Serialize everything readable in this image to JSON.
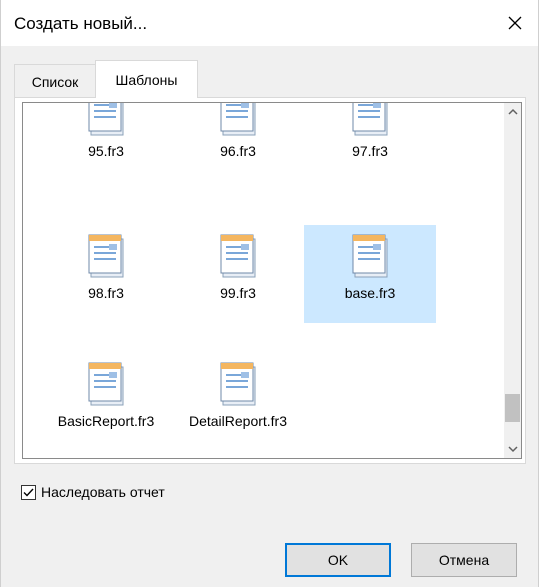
{
  "window": {
    "title": "Создать новый...",
    "close_glyph": "✕"
  },
  "tabs": [
    {
      "label": "Список",
      "active": false
    },
    {
      "label": "Шаблоны",
      "active": true
    }
  ],
  "templates": [
    {
      "label": "95.fr3",
      "selected": false
    },
    {
      "label": "96.fr3",
      "selected": false
    },
    {
      "label": "97.fr3",
      "selected": false
    },
    {
      "label": "98.fr3",
      "selected": false
    },
    {
      "label": "99.fr3",
      "selected": false
    },
    {
      "label": "base.fr3",
      "selected": true
    },
    {
      "label": "BasicReport.fr3",
      "selected": false
    },
    {
      "label": "DetailReport.fr3",
      "selected": false
    }
  ],
  "scrollbar": {
    "up_glyph": "⌃",
    "down_glyph": "⌄"
  },
  "inherit": {
    "label": "Наследовать отчет",
    "checked": true
  },
  "buttons": {
    "ok": "OK",
    "cancel": "Отмена"
  },
  "icons": {
    "template": "report-template-icon",
    "accent": "#0078d7",
    "selection": "#cce8ff"
  }
}
